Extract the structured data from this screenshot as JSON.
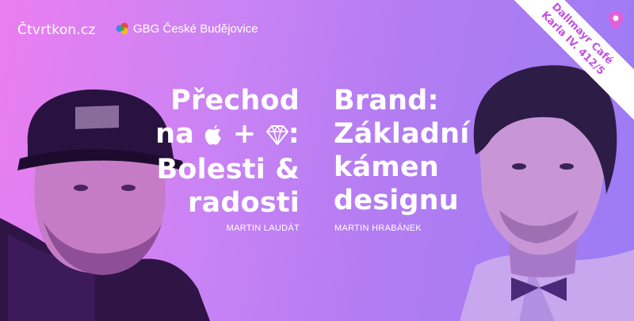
{
  "brand": {
    "logo_text": "Čtvrtkon.cz"
  },
  "partner": {
    "label": "GBG České Budějovice",
    "icon": "gbg-logo-icon"
  },
  "talks": [
    {
      "line1": "Přechod",
      "line2_prefix": "na",
      "line2_plus": "+",
      "line2_suffix": ":",
      "line3": "Bolesti &",
      "line4": "radosti",
      "icons": [
        "apple-icon",
        "sketch-diamond-icon"
      ],
      "speaker": "MARTIN LAUDÁT"
    },
    {
      "line1": "Brand:",
      "line2": "Základní",
      "line3": "kámen",
      "line4": "designu",
      "speaker": "MARTIN HRABÁNEK"
    }
  ],
  "venue": {
    "line1": "Dallmayr Café",
    "line2": "Karla IV. 412/5",
    "icon": "location-pin-icon"
  },
  "colors": {
    "gradient_start": "#ea7ef0",
    "gradient_end": "#9b7cf4",
    "text": "#ffffff",
    "ribbon_text": "#c44fe6"
  }
}
